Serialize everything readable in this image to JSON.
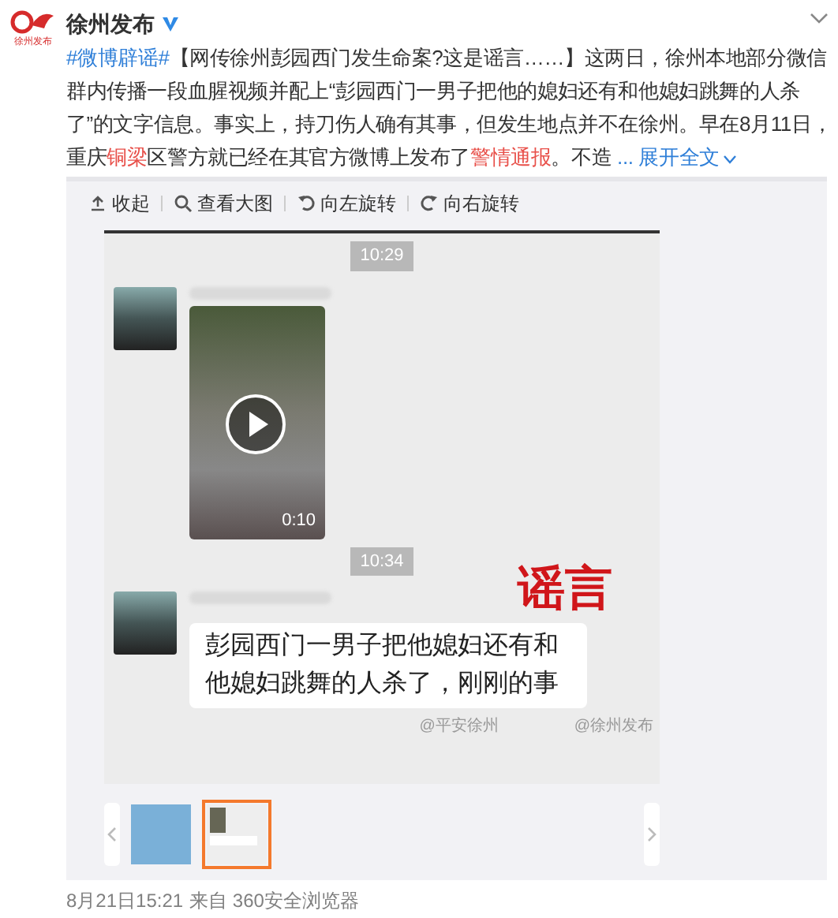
{
  "post": {
    "author": "徐州发布",
    "avatar_text": "徐州发布",
    "verified": true,
    "segments": [
      {
        "kind": "topic",
        "text": "#微博辟谣#"
      },
      {
        "kind": "text",
        "text": "【网传徐州彭园西门发生命案?这是谣言……】这两日，徐州本地部分微信群内传播一段血腥视频并配上“彭园西门一男子把他的媳妇还有和他媳妇跳舞的人杀了”的文字信息。事实上，持刀伤人确有其事，但发生地点并不在徐州。早在8月11日，重庆"
      },
      {
        "kind": "place",
        "text": "铜梁"
      },
      {
        "kind": "text",
        "text": "区警方就已经在其官方微博上发布了"
      },
      {
        "kind": "place",
        "text": "警情通报"
      },
      {
        "kind": "text",
        "text": "。不造 "
      }
    ],
    "more": "... 展开全文"
  },
  "toolbar": [
    "收起",
    "查看大图",
    "向左旋转",
    "向右旋转"
  ],
  "image": {
    "messages": [
      {
        "kind": "video",
        "time": "10:29",
        "duration": "0:10"
      },
      {
        "kind": "text",
        "time": "10:34",
        "stamp": "谣言",
        "text": "彭园西门一男子把他媳妇还有和他媳妇跳舞的人杀了，刚刚的事"
      }
    ],
    "watermarks": [
      "@平安徐州",
      "@徐州发布"
    ]
  },
  "thumbnails": [
    {
      "kind": "notice",
      "selected": false
    },
    {
      "kind": "chat",
      "selected": true
    }
  ],
  "footer": {
    "time": "8月21日15:21",
    "source": "来自 360安全浏览器"
  }
}
